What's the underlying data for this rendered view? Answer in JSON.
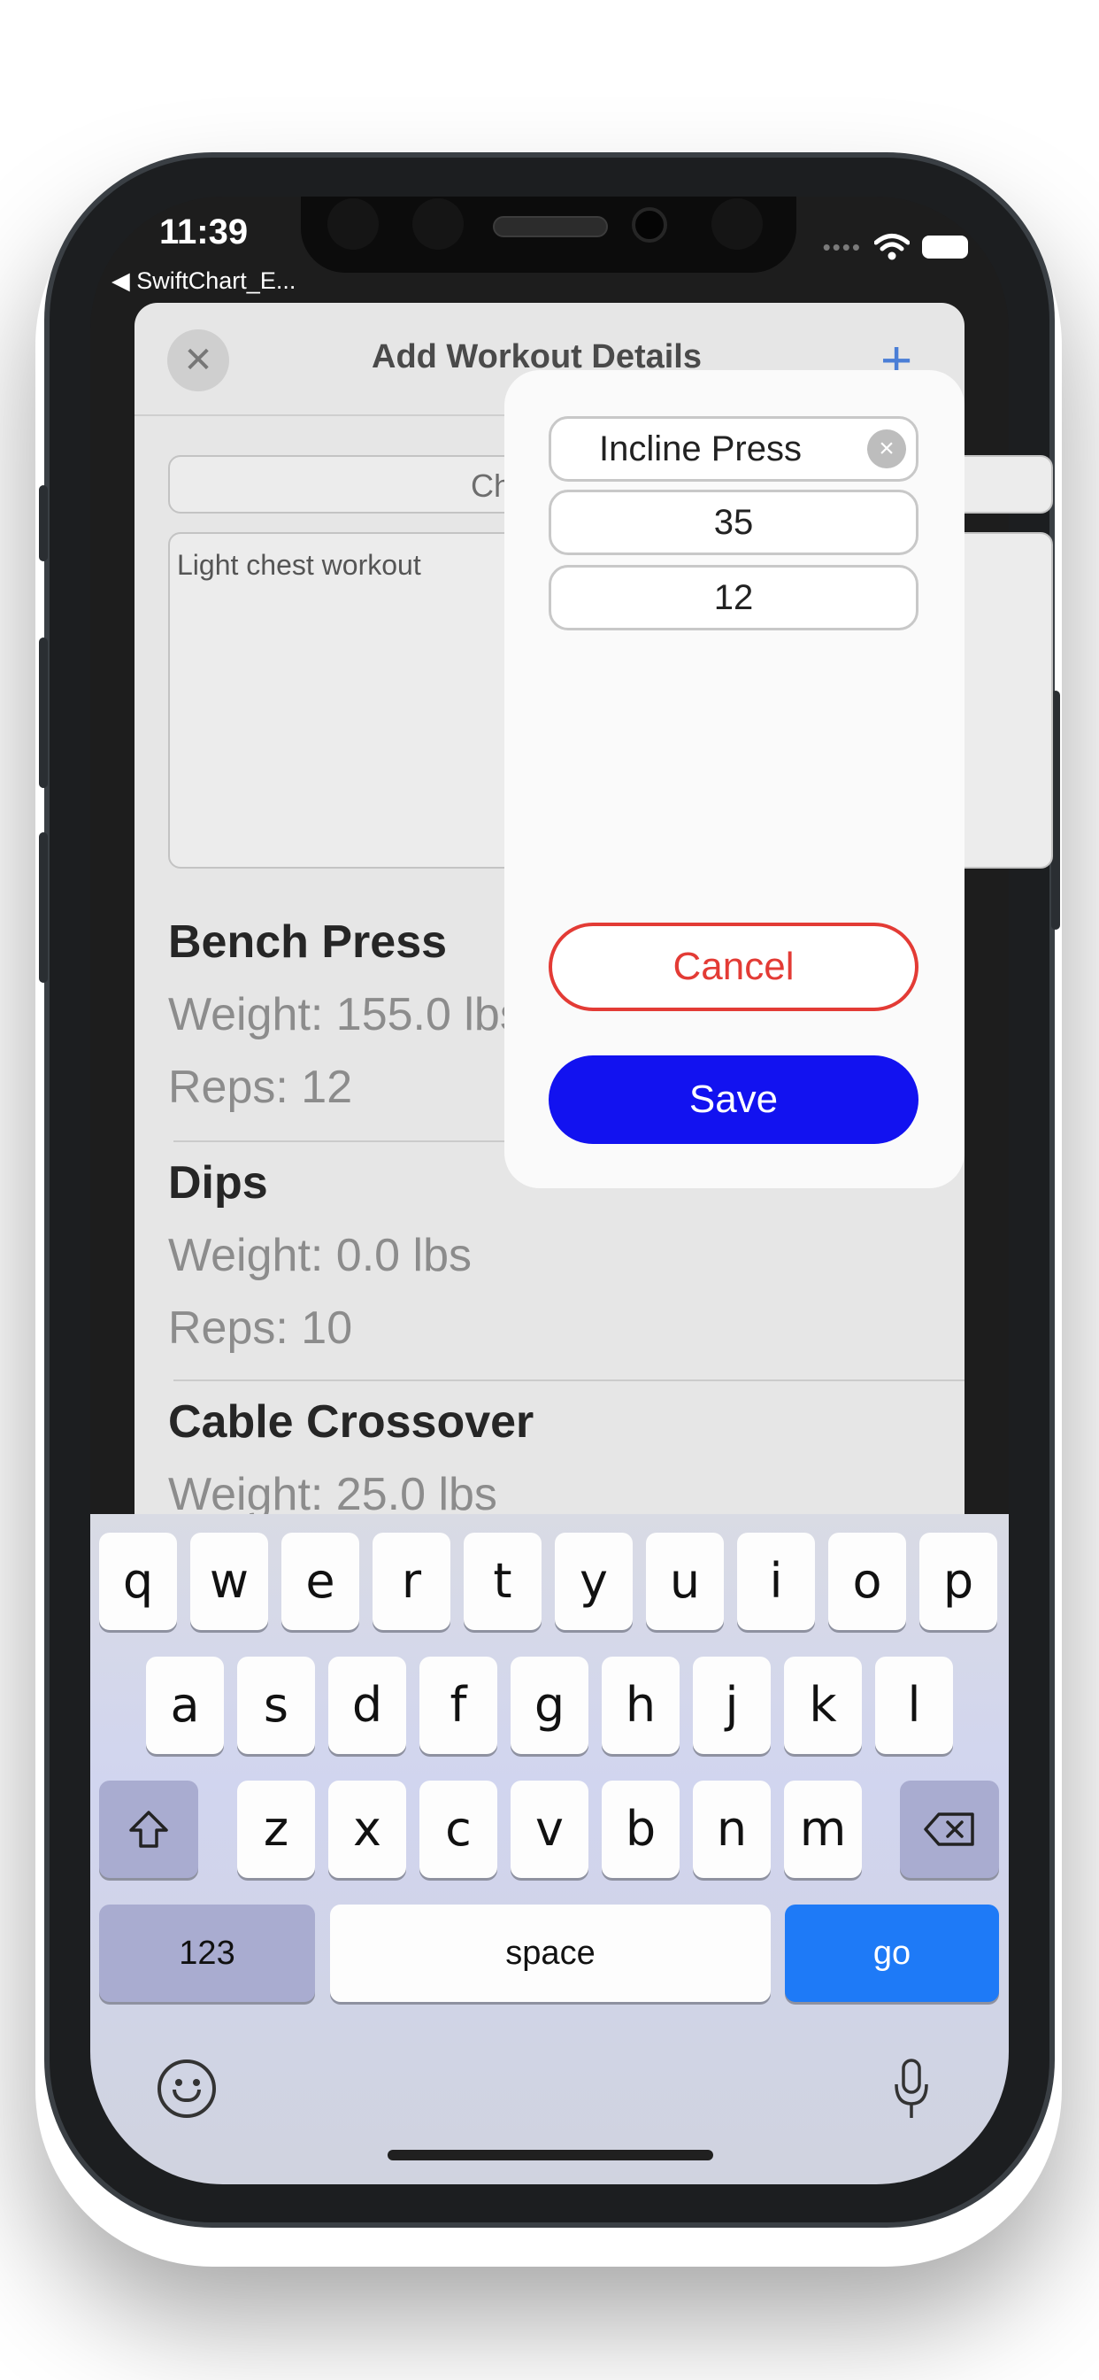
{
  "status_bar": {
    "time": "11:39",
    "back_app": "◀ SwiftChart_E..."
  },
  "sheet": {
    "title": "Add Workout Details",
    "close_icon": "✕",
    "plus_icon": "+",
    "workout_name_partial": "Ch",
    "notes": "Light chest workout"
  },
  "exercises": [
    {
      "name": "Bench Press",
      "weight": "Weight: 155.0 lbs",
      "reps": "Reps: 12"
    },
    {
      "name": "Dips",
      "weight": "Weight: 0.0 lbs",
      "reps": "Reps: 10"
    },
    {
      "name": "Cable Crossover",
      "weight": "Weight: 25.0 lbs"
    }
  ],
  "popup": {
    "exercise_name": "Incline Press",
    "weight": "35",
    "reps": "12",
    "cancel_label": "Cancel",
    "save_label": "Save",
    "cancel_color": "#e33b35",
    "save_color": "#1212f0"
  },
  "keyboard": {
    "row1": [
      "q",
      "w",
      "e",
      "r",
      "t",
      "y",
      "u",
      "i",
      "o",
      "p"
    ],
    "row2": [
      "a",
      "s",
      "d",
      "f",
      "g",
      "h",
      "j",
      "k",
      "l"
    ],
    "row3": [
      "z",
      "x",
      "c",
      "v",
      "b",
      "n",
      "m"
    ],
    "numbers_label": "123",
    "space_label": "space",
    "go_label": "go",
    "accent_color": "#1e7af7"
  }
}
